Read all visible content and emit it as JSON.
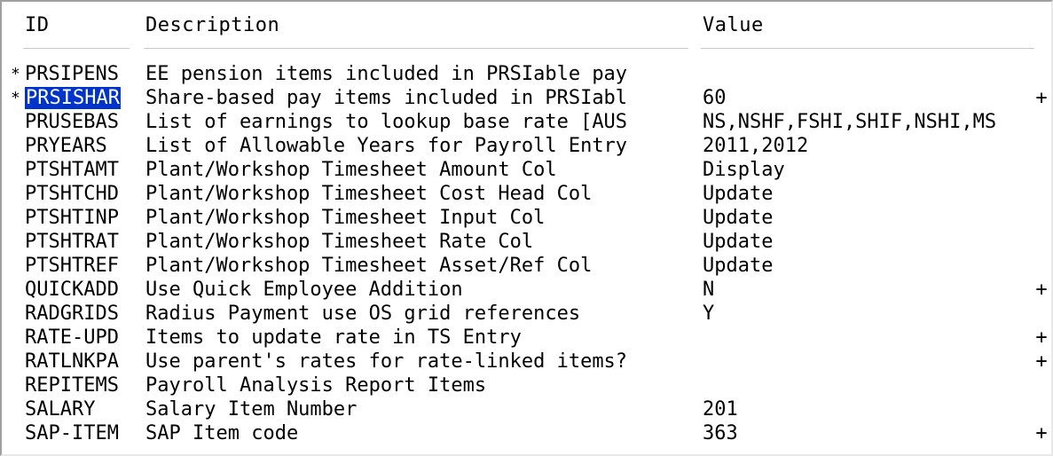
{
  "headers": {
    "id": "ID",
    "description": "Description",
    "value": "Value"
  },
  "selection_color": "#0033cc",
  "rows": [
    {
      "mark": "*",
      "id": "PRSIPENS",
      "description": "EE pension items included in PRSIable pay",
      "value": "",
      "more": "",
      "selected": false
    },
    {
      "mark": "*",
      "id": "PRSISHAR",
      "description": "Share-based pay items included in PRSIabl",
      "value": "60",
      "more": "+",
      "selected": true
    },
    {
      "mark": "",
      "id": "PRUSEBAS",
      "description": "List of earnings to lookup base rate [AUS",
      "value": "NS,NSHF,FSHI,SHIF,NSHI,MS",
      "more": "",
      "selected": false
    },
    {
      "mark": "",
      "id": "PRYEARS",
      "description": "List of Allowable Years for Payroll Entry",
      "value": "2011,2012",
      "more": "",
      "selected": false
    },
    {
      "mark": "",
      "id": "PTSHTAMT",
      "description": "Plant/Workshop Timesheet Amount Col",
      "value": "Display",
      "more": "",
      "selected": false
    },
    {
      "mark": "",
      "id": "PTSHTCHD",
      "description": "Plant/Workshop Timesheet Cost Head Col",
      "value": "Update",
      "more": "",
      "selected": false
    },
    {
      "mark": "",
      "id": "PTSHTINP",
      "description": "Plant/Workshop Timesheet Input Col",
      "value": "Update",
      "more": "",
      "selected": false
    },
    {
      "mark": "",
      "id": "PTSHTRAT",
      "description": "Plant/Workshop Timesheet Rate Col",
      "value": "Update",
      "more": "",
      "selected": false
    },
    {
      "mark": "",
      "id": "PTSHTREF",
      "description": "Plant/Workshop Timesheet Asset/Ref Col",
      "value": "Update",
      "more": "",
      "selected": false
    },
    {
      "mark": "",
      "id": "QUICKADD",
      "description": "Use Quick Employee Addition",
      "value": "N",
      "more": "+",
      "selected": false
    },
    {
      "mark": "",
      "id": "RADGRIDS",
      "description": "Radius Payment use OS grid references",
      "value": "Y",
      "more": "",
      "selected": false
    },
    {
      "mark": "",
      "id": "RATE-UPD",
      "description": "Items to update rate in TS Entry",
      "value": "",
      "more": "+",
      "selected": false
    },
    {
      "mark": "",
      "id": "RATLNKPA",
      "description": "Use parent's rates for rate-linked items?",
      "value": "",
      "more": "+",
      "selected": false
    },
    {
      "mark": "",
      "id": "REPITEMS",
      "description": "Payroll Analysis Report Items",
      "value": "",
      "more": "",
      "selected": false
    },
    {
      "mark": "",
      "id": "SALARY",
      "description": "Salary Item Number",
      "value": "201",
      "more": "",
      "selected": false
    },
    {
      "mark": "",
      "id": "SAP-ITEM",
      "description": "SAP Item code",
      "value": "363",
      "more": "+",
      "selected": false
    }
  ]
}
